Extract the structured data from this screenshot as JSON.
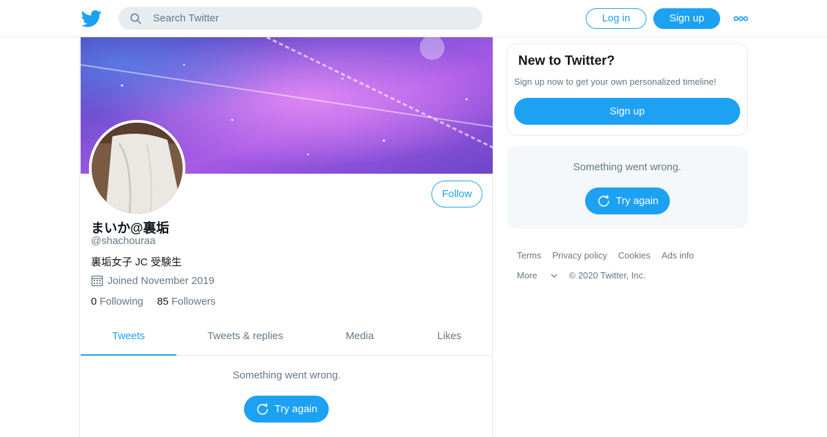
{
  "header": {
    "search_placeholder": "Search Twitter",
    "login_label": "Log in",
    "signup_label": "Sign up",
    "logo_icon": "twitter-bird-icon",
    "more_icon": "more-dots-icon"
  },
  "profile": {
    "display_name": "まいか@裏垢",
    "screen_name": "@shachouraa",
    "bio": "裏垢女子 JC  受験生",
    "joined": "Joined November 2019",
    "following_count": "0",
    "following_label": "Following",
    "followers_count": "85",
    "followers_label": "Followers",
    "follow_label": "Follow"
  },
  "tabs": [
    {
      "label": "Tweets",
      "active": true
    },
    {
      "label": "Tweets & replies",
      "active": false
    },
    {
      "label": "Media",
      "active": false
    },
    {
      "label": "Likes",
      "active": false
    }
  ],
  "timeline": {
    "error_message": "Something went wrong.",
    "try_again_label": "Try again"
  },
  "sidebar": {
    "new_title": "New to Twitter?",
    "new_subtitle": "Sign up now to get your own personalized timeline!",
    "signup_label": "Sign up",
    "error_message": "Something went wrong.",
    "try_again_label": "Try again"
  },
  "footer": {
    "links": [
      "Terms",
      "Privacy policy",
      "Cookies",
      "Ads info"
    ],
    "more_label": "More",
    "copyright": "© 2020 Twitter, Inc."
  },
  "colors": {
    "accent": "#1da1f2",
    "muted": "#657786",
    "border": "#e6ecf0"
  }
}
